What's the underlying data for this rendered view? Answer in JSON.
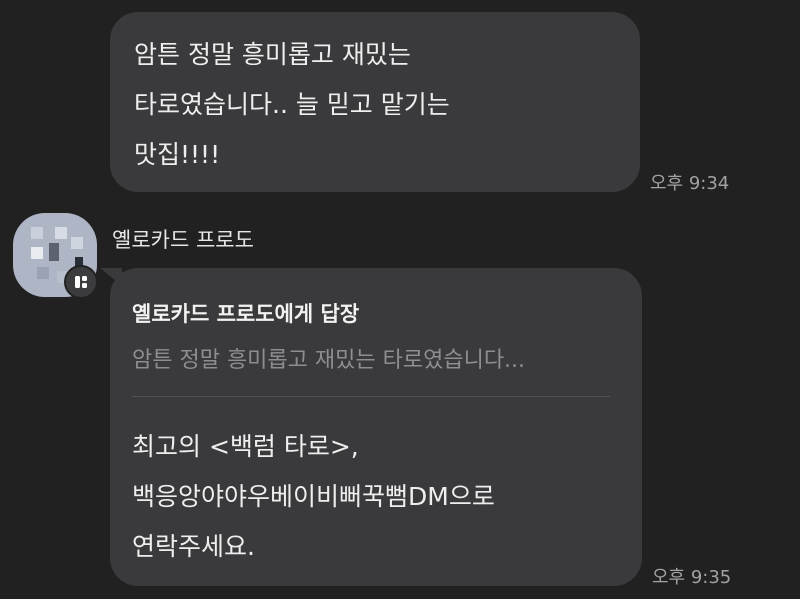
{
  "messages": [
    {
      "text": "암튼 정말 흥미롭고 재밌는\n타로였습니다.. 늘 믿고 맡기는\n맛집!!!!",
      "time": "오후 9:34"
    },
    {
      "sender": "옐로카드 프로도",
      "reply_to_title": "옐로카드 프로도에게 답장",
      "reply_to_preview": "암튼 정말 흥미롭고 재밌는 타로였습니다...",
      "text": "최고의 <백럼 타로>,\n백응앙야야우베이비뻐꾹뻠DM으로\n연락주세요.",
      "time": "오후 9:35"
    }
  ],
  "icons": {
    "avatar": "blurred-avatar-image",
    "badge": "profile-badge-icon"
  },
  "colors": {
    "background": "#212122",
    "bubble": "#3a3a3c",
    "timestamp": "#a2a2a4",
    "reply_preview": "#8e8e92"
  }
}
